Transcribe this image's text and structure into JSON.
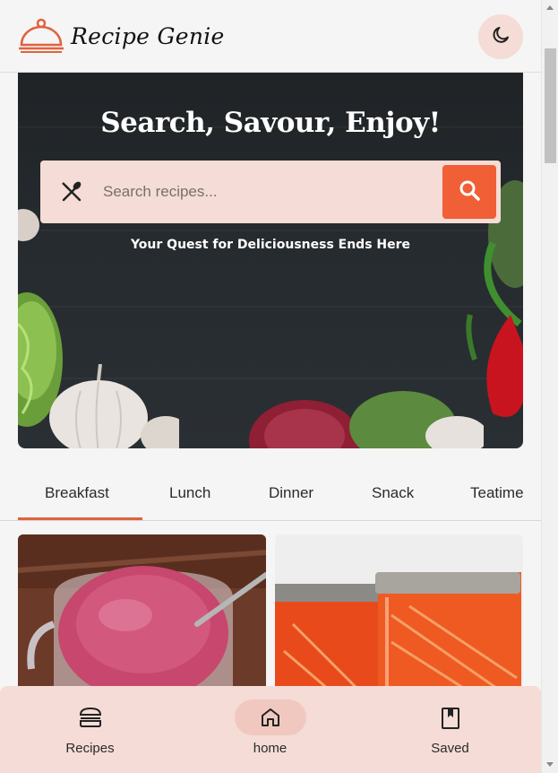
{
  "header": {
    "logo_icon": "cloche-icon",
    "title": "Recipe Genie",
    "theme_toggle_icon": "moon-icon"
  },
  "hero": {
    "title": "Search, Savour, Enjoy!",
    "search": {
      "icon": "utensils-icon",
      "placeholder": "Search recipes...",
      "value": "",
      "button_icon": "search-icon"
    },
    "tagline": "Your Quest for Deliciousness Ends Here"
  },
  "tabs": {
    "items": [
      {
        "label": "Breakfast",
        "active": true
      },
      {
        "label": "Lunch",
        "active": false
      },
      {
        "label": "Dinner",
        "active": false
      },
      {
        "label": "Snack",
        "active": false
      },
      {
        "label": "Teatime",
        "active": false
      }
    ]
  },
  "bottom_nav": {
    "items": [
      {
        "label": "Recipes",
        "icon": "burger-icon",
        "active": false
      },
      {
        "label": "home",
        "icon": "home-icon",
        "active": true
      },
      {
        "label": "Saved",
        "icon": "bookmark-icon",
        "active": false
      }
    ]
  },
  "colors": {
    "accent": "#f05f36",
    "accent_soft": "#f5dcd6",
    "background": "#f5f5f5",
    "text": "#2b2b2b"
  }
}
